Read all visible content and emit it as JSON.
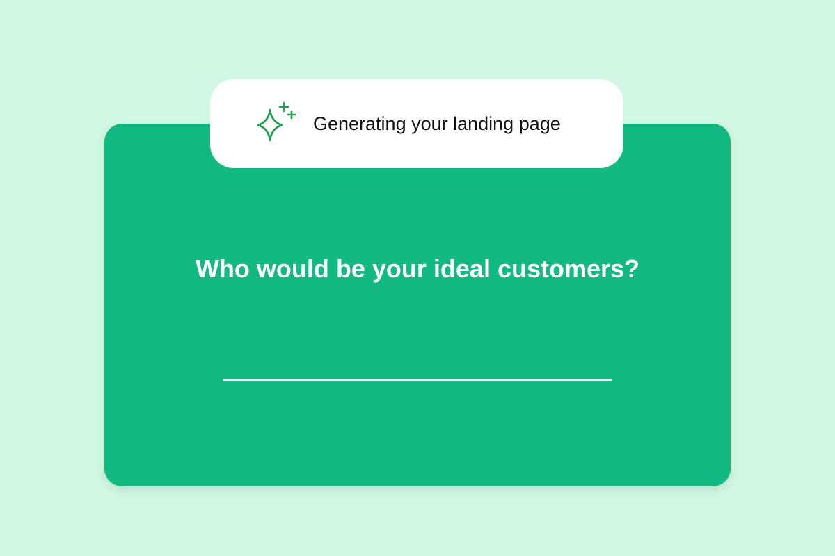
{
  "status": {
    "text": "Generating your landing page",
    "icon": "sparkle-icon"
  },
  "prompt": {
    "question": "Who would be your ideal customers?",
    "answer_value": ""
  },
  "colors": {
    "background": "#d2f8e4",
    "card": "#12b981",
    "accent": "#16a34a",
    "text_light": "#ffffff",
    "text_dark": "#111111"
  }
}
